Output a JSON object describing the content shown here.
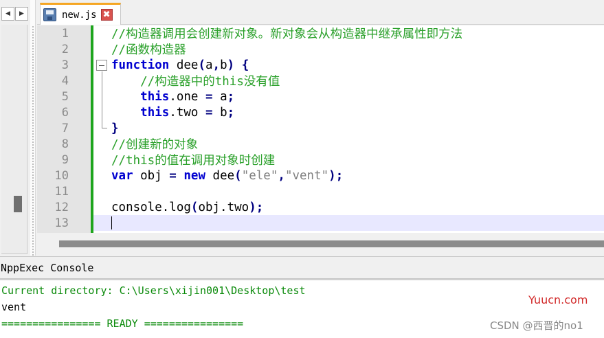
{
  "navigation": {
    "prev_glyph": "◀",
    "next_glyph": "▶"
  },
  "tab": {
    "label": "new.js",
    "icon": "save-icon",
    "close_glyph": "✖"
  },
  "editor": {
    "lines": [
      {
        "num": "1",
        "text": "//构造器调用会创建新对象。新对象会从构造器中继承属性即方法"
      },
      {
        "num": "2",
        "text": "//函数构造器"
      },
      {
        "num": "3",
        "text": "function dee(a,b) {"
      },
      {
        "num": "4",
        "text": "    //构造器中的this没有值"
      },
      {
        "num": "5",
        "text": "    this.one = a;"
      },
      {
        "num": "6",
        "text": "    this.two = b;"
      },
      {
        "num": "7",
        "text": "}"
      },
      {
        "num": "8",
        "text": "//创建新的对象"
      },
      {
        "num": "9",
        "text": "//this的值在调用对象时创建"
      },
      {
        "num": "10",
        "text": "var obj = new dee(\"ele\",\"vent\");"
      },
      {
        "num": "11",
        "text": ""
      },
      {
        "num": "12",
        "text": "console.log(obj.two);"
      },
      {
        "num": "13",
        "text": ""
      }
    ],
    "current_line": "13"
  },
  "console": {
    "title": "NppExec Console",
    "lines": [
      "Current directory: C:\\Users\\xijin001\\Desktop\\test",
      "vent",
      "================ READY ================"
    ]
  },
  "watermarks": {
    "site": "Yuucn.com",
    "author": "CSDN @西晋的no1"
  },
  "colors": {
    "comment": "#2aa02a",
    "keyword": "#0000d0",
    "string": "#808080",
    "change_bar": "#1ea51e",
    "current_line": "#e8e8ff",
    "tab_accent": "#f5a623",
    "console_green": "#0a8a0a"
  }
}
